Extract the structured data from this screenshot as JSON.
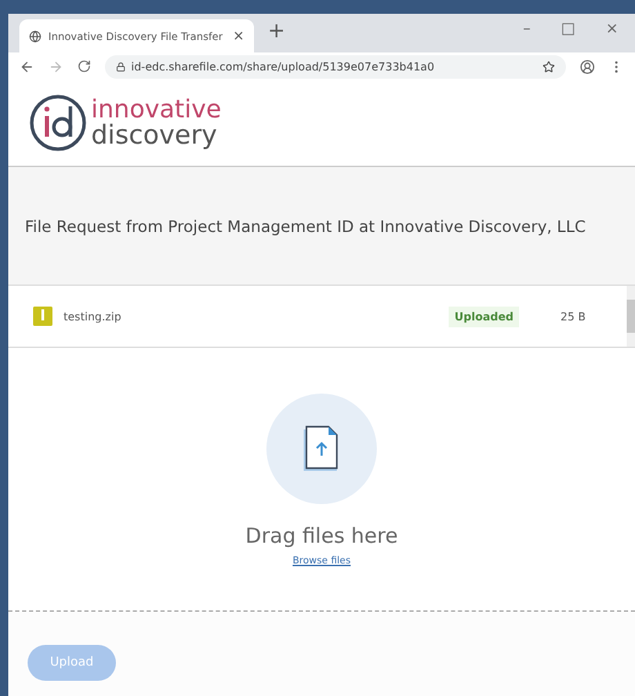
{
  "browser": {
    "tab_title": "Innovative Discovery File Transfer",
    "tab_close": "×",
    "new_tab": "+",
    "window_controls": [
      "–",
      "□",
      "×"
    ],
    "url": "id-edc.sharefile.com/share/upload/5139e07e733b41a0"
  },
  "logo": {
    "top": "innovative",
    "bottom": "discovery"
  },
  "request_title": "File Request from Project Management ID at Innovative Discovery, LLC",
  "files": [
    {
      "name": "testing.zip",
      "status": "Uploaded",
      "size": "25 B"
    }
  ],
  "drop_zone": {
    "text": "Drag files here",
    "link": "Browse files"
  },
  "upload_button": {
    "label": "Upload",
    "disabled": true
  }
}
